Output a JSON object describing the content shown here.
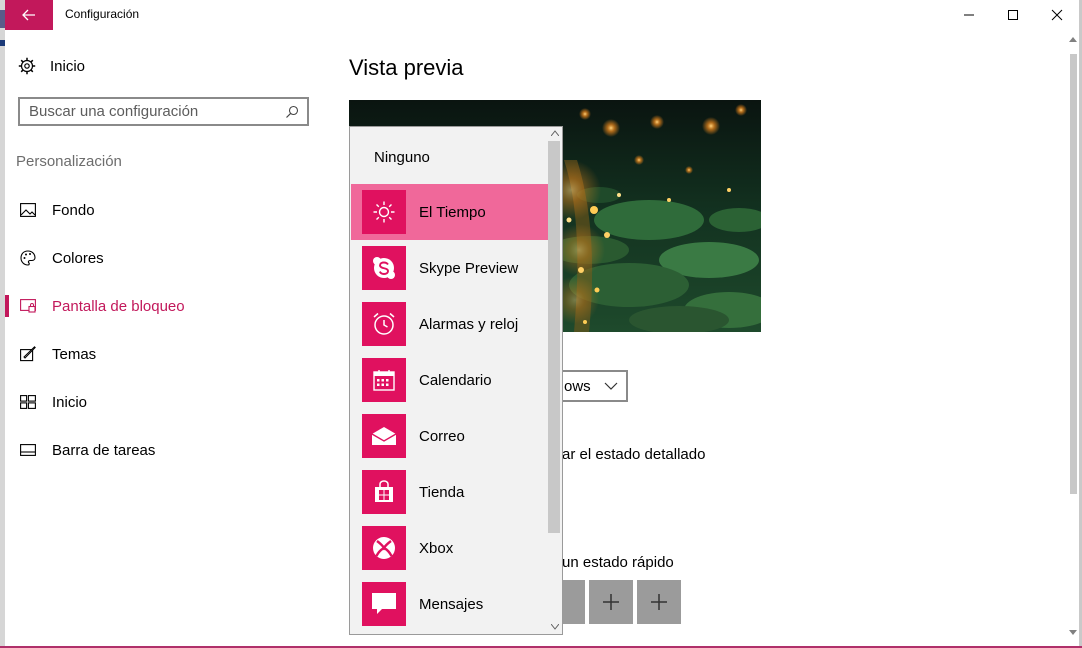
{
  "window": {
    "title": "Configuración",
    "icons": {
      "back": "back-arrow-icon",
      "minimize": "minimize-icon",
      "maximize": "maximize-icon",
      "close": "close-icon"
    }
  },
  "sidebar": {
    "home_label": "Inicio",
    "search": {
      "placeholder": "Buscar una configuración",
      "value": ""
    },
    "section_label": "Personalización",
    "items": [
      {
        "label": "Fondo",
        "icon": "picture-icon",
        "active": false
      },
      {
        "label": "Colores",
        "icon": "palette-icon",
        "active": false
      },
      {
        "label": "Pantalla de bloqueo",
        "icon": "lock-screen-icon",
        "active": true
      },
      {
        "label": "Temas",
        "icon": "themes-icon",
        "active": false
      },
      {
        "label": "Inicio",
        "icon": "start-icon",
        "active": false
      },
      {
        "label": "Barra de tareas",
        "icon": "taskbar-icon",
        "active": false
      }
    ]
  },
  "main": {
    "title": "Vista previa",
    "combo_partial": "ows",
    "partial_text_1": "ar el estado detallado",
    "partial_text_2": "un estado rápido"
  },
  "dropdown": {
    "none_label": "Ninguno",
    "items": [
      {
        "label": "El Tiempo",
        "icon": "weather-sun-icon",
        "selected": true
      },
      {
        "label": "Skype Preview",
        "icon": "skype-icon",
        "selected": false
      },
      {
        "label": "Alarmas y reloj",
        "icon": "alarm-clock-icon",
        "selected": false
      },
      {
        "label": "Calendario",
        "icon": "calendar-icon",
        "selected": false
      },
      {
        "label": "Correo",
        "icon": "mail-icon",
        "selected": false
      },
      {
        "label": "Tienda",
        "icon": "store-icon",
        "selected": false
      },
      {
        "label": "Xbox",
        "icon": "xbox-icon",
        "selected": false
      },
      {
        "label": "Mensajes",
        "icon": "messages-icon",
        "selected": false
      }
    ]
  },
  "colors": {
    "accent": "#c2185b",
    "tile": "#e0115f",
    "selected": "#f0689a"
  }
}
